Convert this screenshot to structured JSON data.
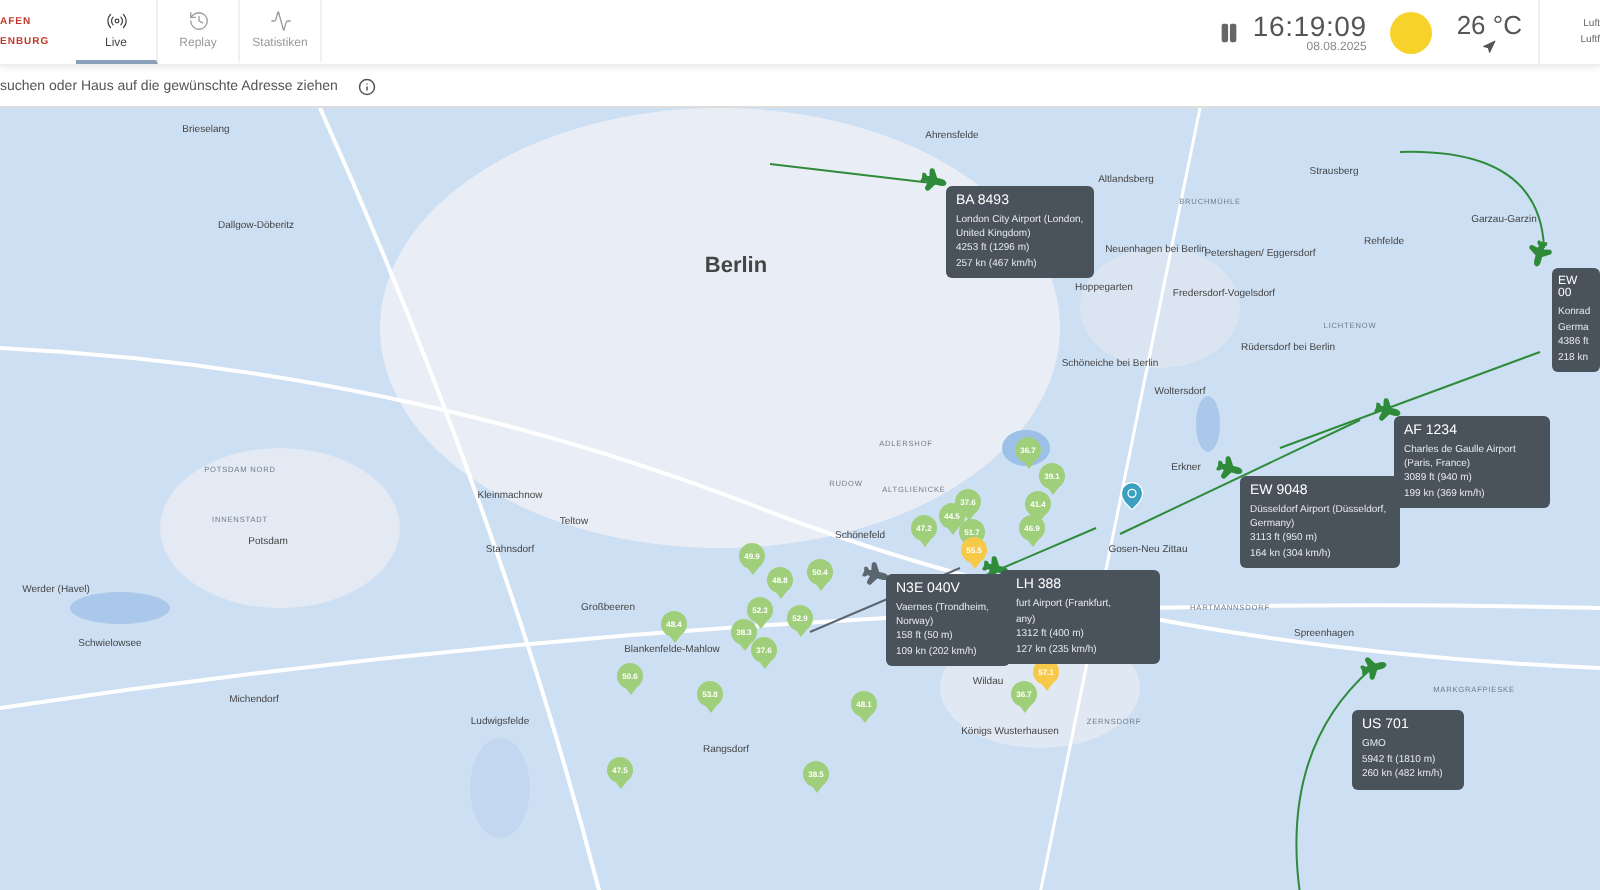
{
  "brand": {
    "lines": [
      "AFEN",
      "ENBURG"
    ]
  },
  "tabs": [
    {
      "label": "Live",
      "selected": true
    },
    {
      "label": "Replay",
      "selected": false
    },
    {
      "label": "Statistiken",
      "selected": false
    }
  ],
  "clock": {
    "time": "16:19:09",
    "date": "08.08.2025"
  },
  "weather": {
    "temperature": "26 °C"
  },
  "right_labels": [
    "Luft",
    "Luftf"
  ],
  "search": {
    "hint": "suchen oder Haus auf die gewünschte Adresse ziehen"
  },
  "places": [
    {
      "name": "Brieselang",
      "kind": "town"
    },
    {
      "name": "Ahrensfelde",
      "kind": "town"
    },
    {
      "name": "Strausberg",
      "kind": "town"
    },
    {
      "name": "Altlandsberg",
      "kind": "town"
    },
    {
      "name": "BRUCHMÜHLE",
      "kind": "district"
    },
    {
      "name": "Garzau-Garzin",
      "kind": "town"
    },
    {
      "name": "Dallgow-Döberitz",
      "kind": "town"
    },
    {
      "name": "Rehfelde",
      "kind": "town"
    },
    {
      "name": "Neuenhagen bei Berlin",
      "kind": "town"
    },
    {
      "name": "Petershagen/ Eggersdorf",
      "kind": "town"
    },
    {
      "name": "Berlin",
      "kind": "city"
    },
    {
      "name": "Hoppegarten",
      "kind": "town"
    },
    {
      "name": "Fredersdorf-Vogelsdorf",
      "kind": "town"
    },
    {
      "name": "LICHTENOW",
      "kind": "district"
    },
    {
      "name": "Rüdersdorf bei Berlin",
      "kind": "town"
    },
    {
      "name": "Schöneiche bei Berlin",
      "kind": "town"
    },
    {
      "name": "Woltersdorf",
      "kind": "town"
    },
    {
      "name": "ADLERSHOF",
      "kind": "district"
    },
    {
      "name": "Erkner",
      "kind": "town"
    },
    {
      "name": "POTSDAM NORD",
      "kind": "district"
    },
    {
      "name": "RUDOW",
      "kind": "district"
    },
    {
      "name": "ALTGLIENICKE",
      "kind": "district"
    },
    {
      "name": "Kleinmachnow",
      "kind": "town"
    },
    {
      "name": "INNENSTADT",
      "kind": "district"
    },
    {
      "name": "Teltow",
      "kind": "town"
    },
    {
      "name": "Gosen-Neu Zittau",
      "kind": "town"
    },
    {
      "name": "Schönefeld",
      "kind": "town"
    },
    {
      "name": "Potsdam",
      "kind": "town"
    },
    {
      "name": "Stahnsdorf",
      "kind": "town"
    },
    {
      "name": "Werder (Havel)",
      "kind": "town"
    },
    {
      "name": "Großbeeren",
      "kind": "town"
    },
    {
      "name": "HARTMANNSDORF",
      "kind": "district"
    },
    {
      "name": "Spreenhagen",
      "kind": "town"
    },
    {
      "name": "Schwielowsee",
      "kind": "town"
    },
    {
      "name": "Blankenfelde-Mahlow",
      "kind": "town"
    },
    {
      "name": "Wildau",
      "kind": "town"
    },
    {
      "name": "MARKGRAFPIESKE",
      "kind": "district"
    },
    {
      "name": "Michendorf",
      "kind": "town"
    },
    {
      "name": "Ludwigsfelde",
      "kind": "town"
    },
    {
      "name": "ZERNSDORF",
      "kind": "district"
    },
    {
      "name": "Königs Wusterhausen",
      "kind": "town"
    },
    {
      "name": "Rangsdorf",
      "kind": "town"
    }
  ],
  "noise_pins": [
    {
      "value": "36.7",
      "color": "#9fcf7a"
    },
    {
      "value": "39.1",
      "color": "#9fcf7a"
    },
    {
      "value": "41.4",
      "color": "#9fcf7a"
    },
    {
      "value": "46.9",
      "color": "#9fcf7a"
    },
    {
      "value": "37.6",
      "color": "#9fcf7a"
    },
    {
      "value": "44.5",
      "color": "#9fcf7a"
    },
    {
      "value": "47.2",
      "color": "#9fcf7a"
    },
    {
      "value": "51.7",
      "color": "#9fcf7a"
    },
    {
      "value": "55.5",
      "color": "#f7c948"
    },
    {
      "value": "49.9",
      "color": "#9fcf7a"
    },
    {
      "value": "48.8",
      "color": "#9fcf7a"
    },
    {
      "value": "50.4",
      "color": "#9fcf7a"
    },
    {
      "value": "52.3",
      "color": "#9fcf7a"
    },
    {
      "value": "38.3",
      "color": "#9fcf7a"
    },
    {
      "value": "37.6",
      "color": "#9fcf7a"
    },
    {
      "value": "48.4",
      "color": "#9fcf7a"
    },
    {
      "value": "52.9",
      "color": "#9fcf7a"
    },
    {
      "value": "50.6",
      "color": "#9fcf7a"
    },
    {
      "value": "53.8",
      "color": "#9fcf7a"
    },
    {
      "value": "48.1",
      "color": "#9fcf7a"
    },
    {
      "value": "57.1",
      "color": "#f7c948"
    },
    {
      "value": "36.7",
      "color": "#9fcf7a"
    },
    {
      "value": "47.5",
      "color": "#9fcf7a"
    },
    {
      "value": "38.5",
      "color": "#9fcf7a"
    }
  ],
  "flights": [
    {
      "number": "BA 8493",
      "lines": [
        "London City Airport (London, United Kingdom)",
        "4253 ft (1296 m)",
        "257 kn (467 km/h)"
      ]
    },
    {
      "number": "EW 00",
      "lines": [
        "Konrad",
        "Germa",
        "4386 ft",
        "218 kn"
      ]
    },
    {
      "number": "AF 1234",
      "lines": [
        "Charles de Gaulle Airport (Paris, France)",
        "3089 ft (940 m)",
        "199 kn (369 km/h)"
      ]
    },
    {
      "number": "EW 9048",
      "lines": [
        "Düsseldorf Airport (Düsseldorf, Germany)",
        "3113 ft (950 m)",
        "164 kn (304 km/h)"
      ]
    },
    {
      "number": "N3E 040V",
      "lines": [
        "Vaernes (Trondheim, Norway)",
        "158 ft (50 m)",
        "109 kn (202 km/h)"
      ]
    },
    {
      "number": "LH 388",
      "lines": [
        "furt Airport (Frankfurt,",
        "any)",
        "1312 ft (400 m)",
        "127 kn (235 km/h)"
      ]
    },
    {
      "number": "US 701",
      "lines": [
        "GMO",
        "5942 ft (1810 m)",
        "260 kn (482 km/h)"
      ]
    }
  ]
}
